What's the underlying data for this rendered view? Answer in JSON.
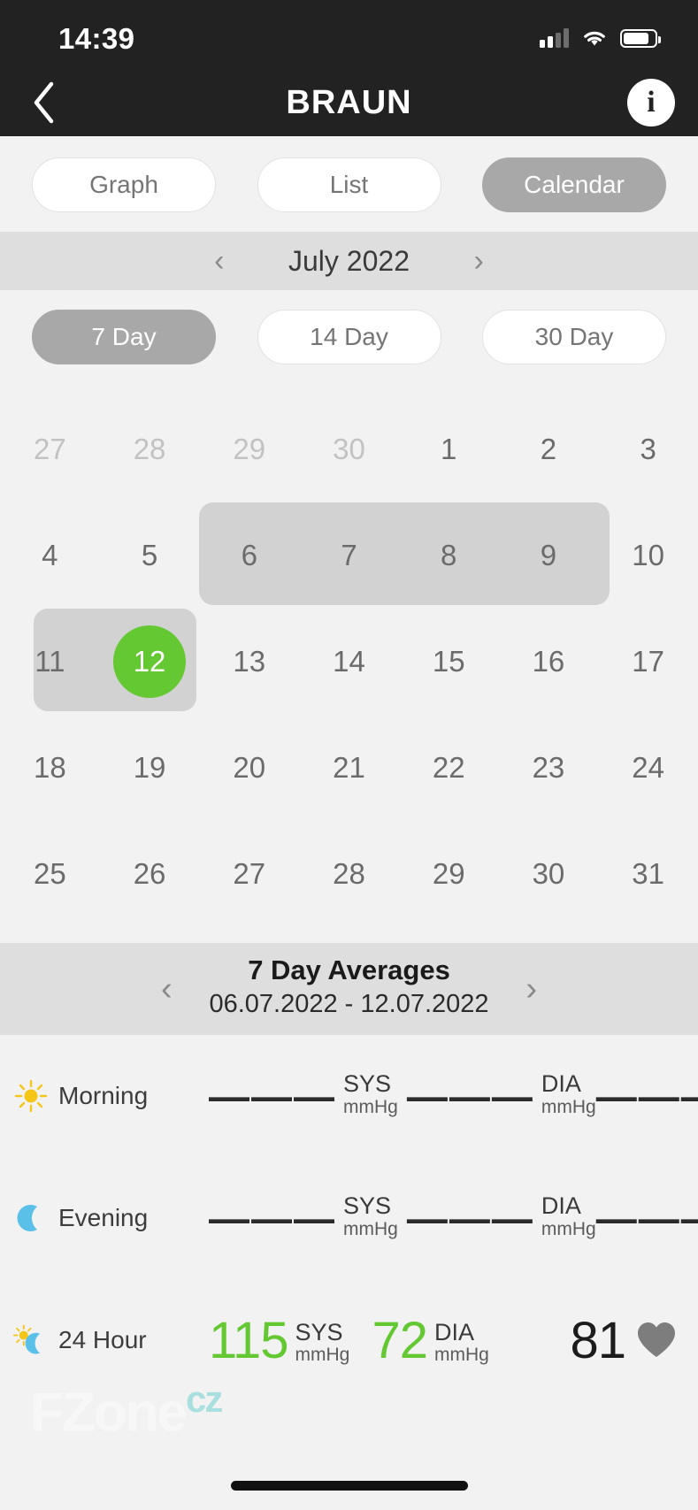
{
  "status_bar": {
    "time": "14:39",
    "signal_icon": "cellular-signal-icon",
    "wifi_icon": "wifi-icon",
    "battery_icon": "battery-icon"
  },
  "nav": {
    "back_icon": "back-chevron-icon",
    "brand": "BRAUN",
    "info_icon": "info-icon",
    "info_glyph": "i"
  },
  "view_tabs": [
    {
      "label": "Graph",
      "active": false
    },
    {
      "label": "List",
      "active": false
    },
    {
      "label": "Calendar",
      "active": true
    }
  ],
  "month_nav": {
    "prev_icon": "chevron-left-icon",
    "prev_glyph": "‹",
    "title": "July 2022",
    "next_icon": "chevron-right-icon",
    "next_glyph": "›"
  },
  "range_tabs": [
    {
      "label": "7 Day",
      "active": true
    },
    {
      "label": "14 Day",
      "active": false
    },
    {
      "label": "30 Day",
      "active": false
    }
  ],
  "calendar": {
    "selected_day": 12,
    "selected_color": "#64c832",
    "range_highlight_color": "#d2d2d2",
    "weeks": [
      [
        {
          "d": "27",
          "muted": true
        },
        {
          "d": "28",
          "muted": true
        },
        {
          "d": "29",
          "muted": true
        },
        {
          "d": "30",
          "muted": true
        },
        {
          "d": "1",
          "muted": false
        },
        {
          "d": "2",
          "muted": false
        },
        {
          "d": "3",
          "muted": false
        }
      ],
      [
        {
          "d": "4",
          "muted": false
        },
        {
          "d": "5",
          "muted": false
        },
        {
          "d": "6",
          "muted": false
        },
        {
          "d": "7",
          "muted": false
        },
        {
          "d": "8",
          "muted": false
        },
        {
          "d": "9",
          "muted": false
        },
        {
          "d": "10",
          "muted": false
        }
      ],
      [
        {
          "d": "11",
          "muted": false
        },
        {
          "d": "12",
          "muted": false,
          "today": true
        },
        {
          "d": "13",
          "muted": false
        },
        {
          "d": "14",
          "muted": false
        },
        {
          "d": "15",
          "muted": false
        },
        {
          "d": "16",
          "muted": false
        },
        {
          "d": "17",
          "muted": false
        }
      ],
      [
        {
          "d": "18",
          "muted": false
        },
        {
          "d": "19",
          "muted": false
        },
        {
          "d": "20",
          "muted": false
        },
        {
          "d": "21",
          "muted": false
        },
        {
          "d": "22",
          "muted": false
        },
        {
          "d": "23",
          "muted": false
        },
        {
          "d": "24",
          "muted": false
        }
      ],
      [
        {
          "d": "25",
          "muted": false
        },
        {
          "d": "26",
          "muted": false
        },
        {
          "d": "27",
          "muted": false
        },
        {
          "d": "28",
          "muted": false
        },
        {
          "d": "29",
          "muted": false
        },
        {
          "d": "30",
          "muted": false
        },
        {
          "d": "31",
          "muted": false
        }
      ]
    ]
  },
  "averages_header": {
    "prev_icon": "chevron-left-icon",
    "prev_glyph": "‹",
    "title": "7 Day Averages",
    "date_range": "06.07.2022 - 12.07.2022",
    "next_icon": "chevron-right-icon",
    "next_glyph": "›"
  },
  "measurements": [
    {
      "icon": "sun-icon",
      "label": "Morning",
      "sys_value": "———",
      "sys_unit_name": "SYS",
      "sys_unit": "mmHg",
      "dia_value": "———",
      "dia_unit_name": "DIA",
      "dia_unit": "mmHg",
      "pulse_value": "———",
      "pulse_icon": "heart-icon",
      "has_data": false
    },
    {
      "icon": "moon-icon",
      "label": "Evening",
      "sys_value": "———",
      "sys_unit_name": "SYS",
      "sys_unit": "mmHg",
      "dia_value": "———",
      "dia_unit_name": "DIA",
      "dia_unit": "mmHg",
      "pulse_value": "———",
      "pulse_icon": "heart-icon",
      "has_data": false
    },
    {
      "icon": "sun-moon-icon",
      "label": "24 Hour",
      "sys_value": "115",
      "sys_unit_name": "SYS",
      "sys_unit": "mmHg",
      "dia_value": "72",
      "dia_unit_name": "DIA",
      "dia_unit": "mmHg",
      "pulse_value": "81",
      "pulse_icon": "heart-icon",
      "has_data": true
    }
  ],
  "watermark": {
    "main": "FZone",
    "suffix": "cz"
  },
  "colors": {
    "accent_green": "#64c832",
    "nav_dark": "#222222",
    "pill_active": "#a8a8a8",
    "heart_gray": "#7d7d7d",
    "sun_yellow": "#f5c518",
    "moon_blue": "#5bc0e8"
  }
}
